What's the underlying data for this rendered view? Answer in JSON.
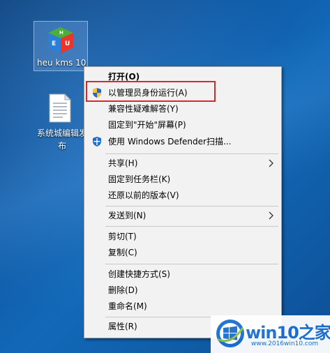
{
  "desktop": {
    "icon1_label": "heu kms 10",
    "icon2_label": "系统城编辑发布"
  },
  "menu": {
    "open": "打开(O)",
    "run_as_admin": "以管理员身份运行(A)",
    "compat": "兼容性疑难解答(Y)",
    "pin_start": "固定到\"开始\"屏幕(P)",
    "defender": "使用 Windows Defender扫描...",
    "share": "共享(H)",
    "pin_taskbar": "固定到任务栏(K)",
    "restore": "还原以前的版本(V)",
    "send_to": "发送到(N)",
    "cut": "剪切(T)",
    "copy": "复制(C)",
    "shortcut": "创建快捷方式(S)",
    "delete": "删除(D)",
    "rename": "重命名(M)",
    "properties": "属性(R)"
  },
  "watermark": {
    "title": "win10之家",
    "url": "www.2016win10.com"
  },
  "colors": {
    "highlight": "#e0252a",
    "brand": "#1a6fd0"
  }
}
